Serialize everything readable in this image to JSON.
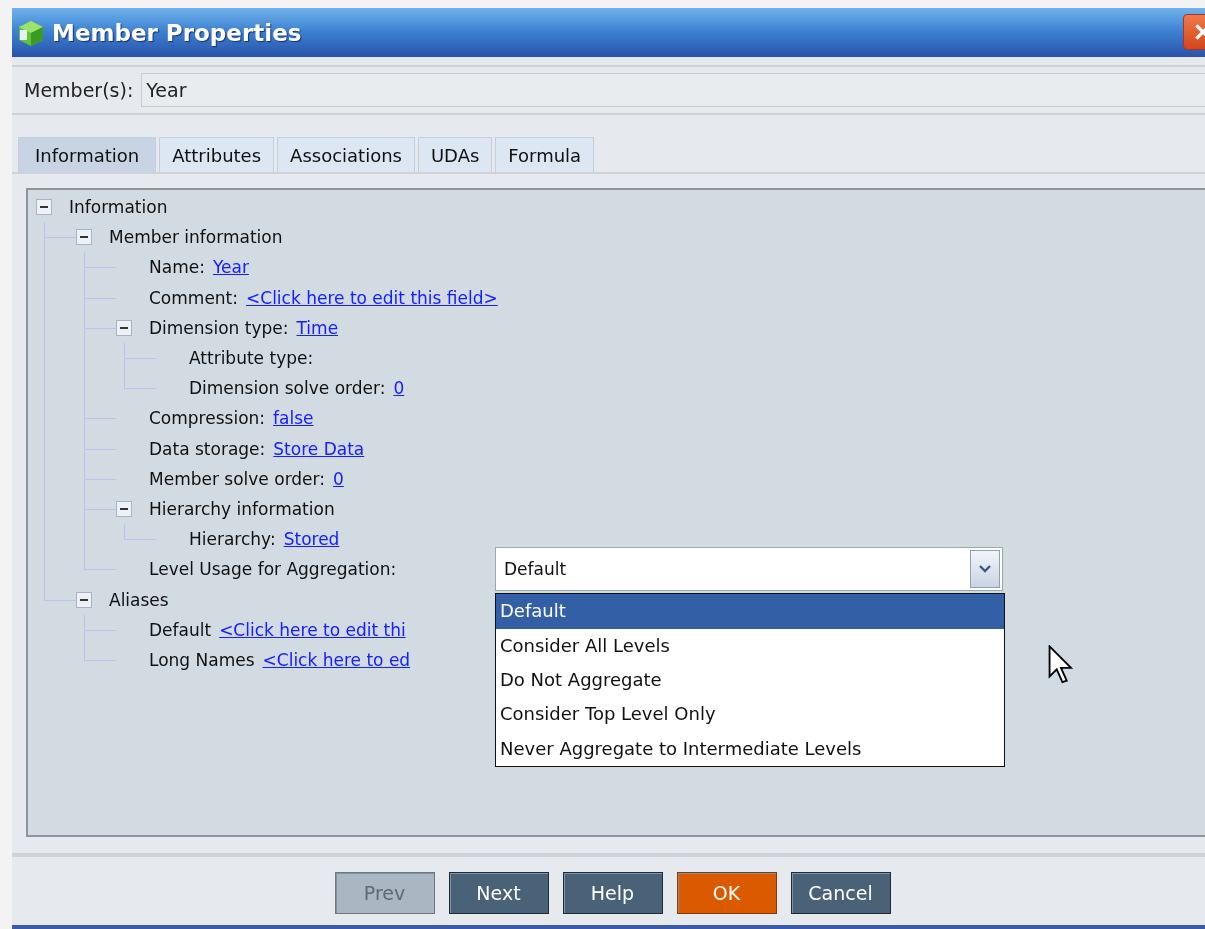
{
  "window": {
    "title": "Member Properties"
  },
  "member_field": {
    "label": "Member(s):",
    "value": "Year"
  },
  "tabs": [
    {
      "label": "Information",
      "selected": true
    },
    {
      "label": "Attributes",
      "selected": false
    },
    {
      "label": "Associations",
      "selected": false
    },
    {
      "label": "UDAs",
      "selected": false
    },
    {
      "label": "Formula",
      "selected": false
    }
  ],
  "tree": [
    {
      "label": "Information",
      "expanded": true,
      "children": [
        {
          "label": "Member information",
          "expanded": true,
          "children": [
            {
              "label": "Name:",
              "link": "Year"
            },
            {
              "label": "Comment:",
              "link": "<Click here to edit this field>"
            },
            {
              "label": "Dimension type:",
              "link": "Time",
              "expanded": true,
              "children": [
                {
                  "label": "Attribute type:"
                },
                {
                  "label": "Dimension solve order:",
                  "link": "0"
                }
              ]
            },
            {
              "label": "Compression:",
              "link": "false"
            },
            {
              "label": "Data storage:",
              "link": "Store Data"
            },
            {
              "label": "Member solve order:",
              "link": "0"
            },
            {
              "label": "Hierarchy information",
              "expanded": true,
              "children": [
                {
                  "label": "Hierarchy:",
                  "link": "Stored"
                }
              ]
            },
            {
              "label": "Level Usage for Aggregation:",
              "kind": "dropdown",
              "value": "Default",
              "options": [
                {
                  "label": "Default",
                  "selected": true
                },
                {
                  "label": "Consider All Levels",
                  "selected": false
                },
                {
                  "label": "Do Not Aggregate",
                  "selected": false
                },
                {
                  "label": "Consider Top Level Only",
                  "selected": false
                },
                {
                  "label": "Never Aggregate to Intermediate Levels",
                  "selected": false
                }
              ]
            }
          ]
        },
        {
          "label": "Aliases",
          "expanded": true,
          "children": [
            {
              "label": "Default",
              "link": "<Click here to edit thi"
            },
            {
              "label": "Long Names",
              "link": "<Click here to ed"
            }
          ]
        }
      ]
    }
  ],
  "buttons": [
    {
      "label": "Prev",
      "kind": "normal",
      "disabled": true
    },
    {
      "label": "Next",
      "kind": "normal",
      "disabled": false
    },
    {
      "label": "Help",
      "kind": "normal",
      "disabled": false
    },
    {
      "label": "OK",
      "kind": "primary",
      "disabled": false
    },
    {
      "label": "Cancel",
      "kind": "normal",
      "disabled": false
    }
  ]
}
